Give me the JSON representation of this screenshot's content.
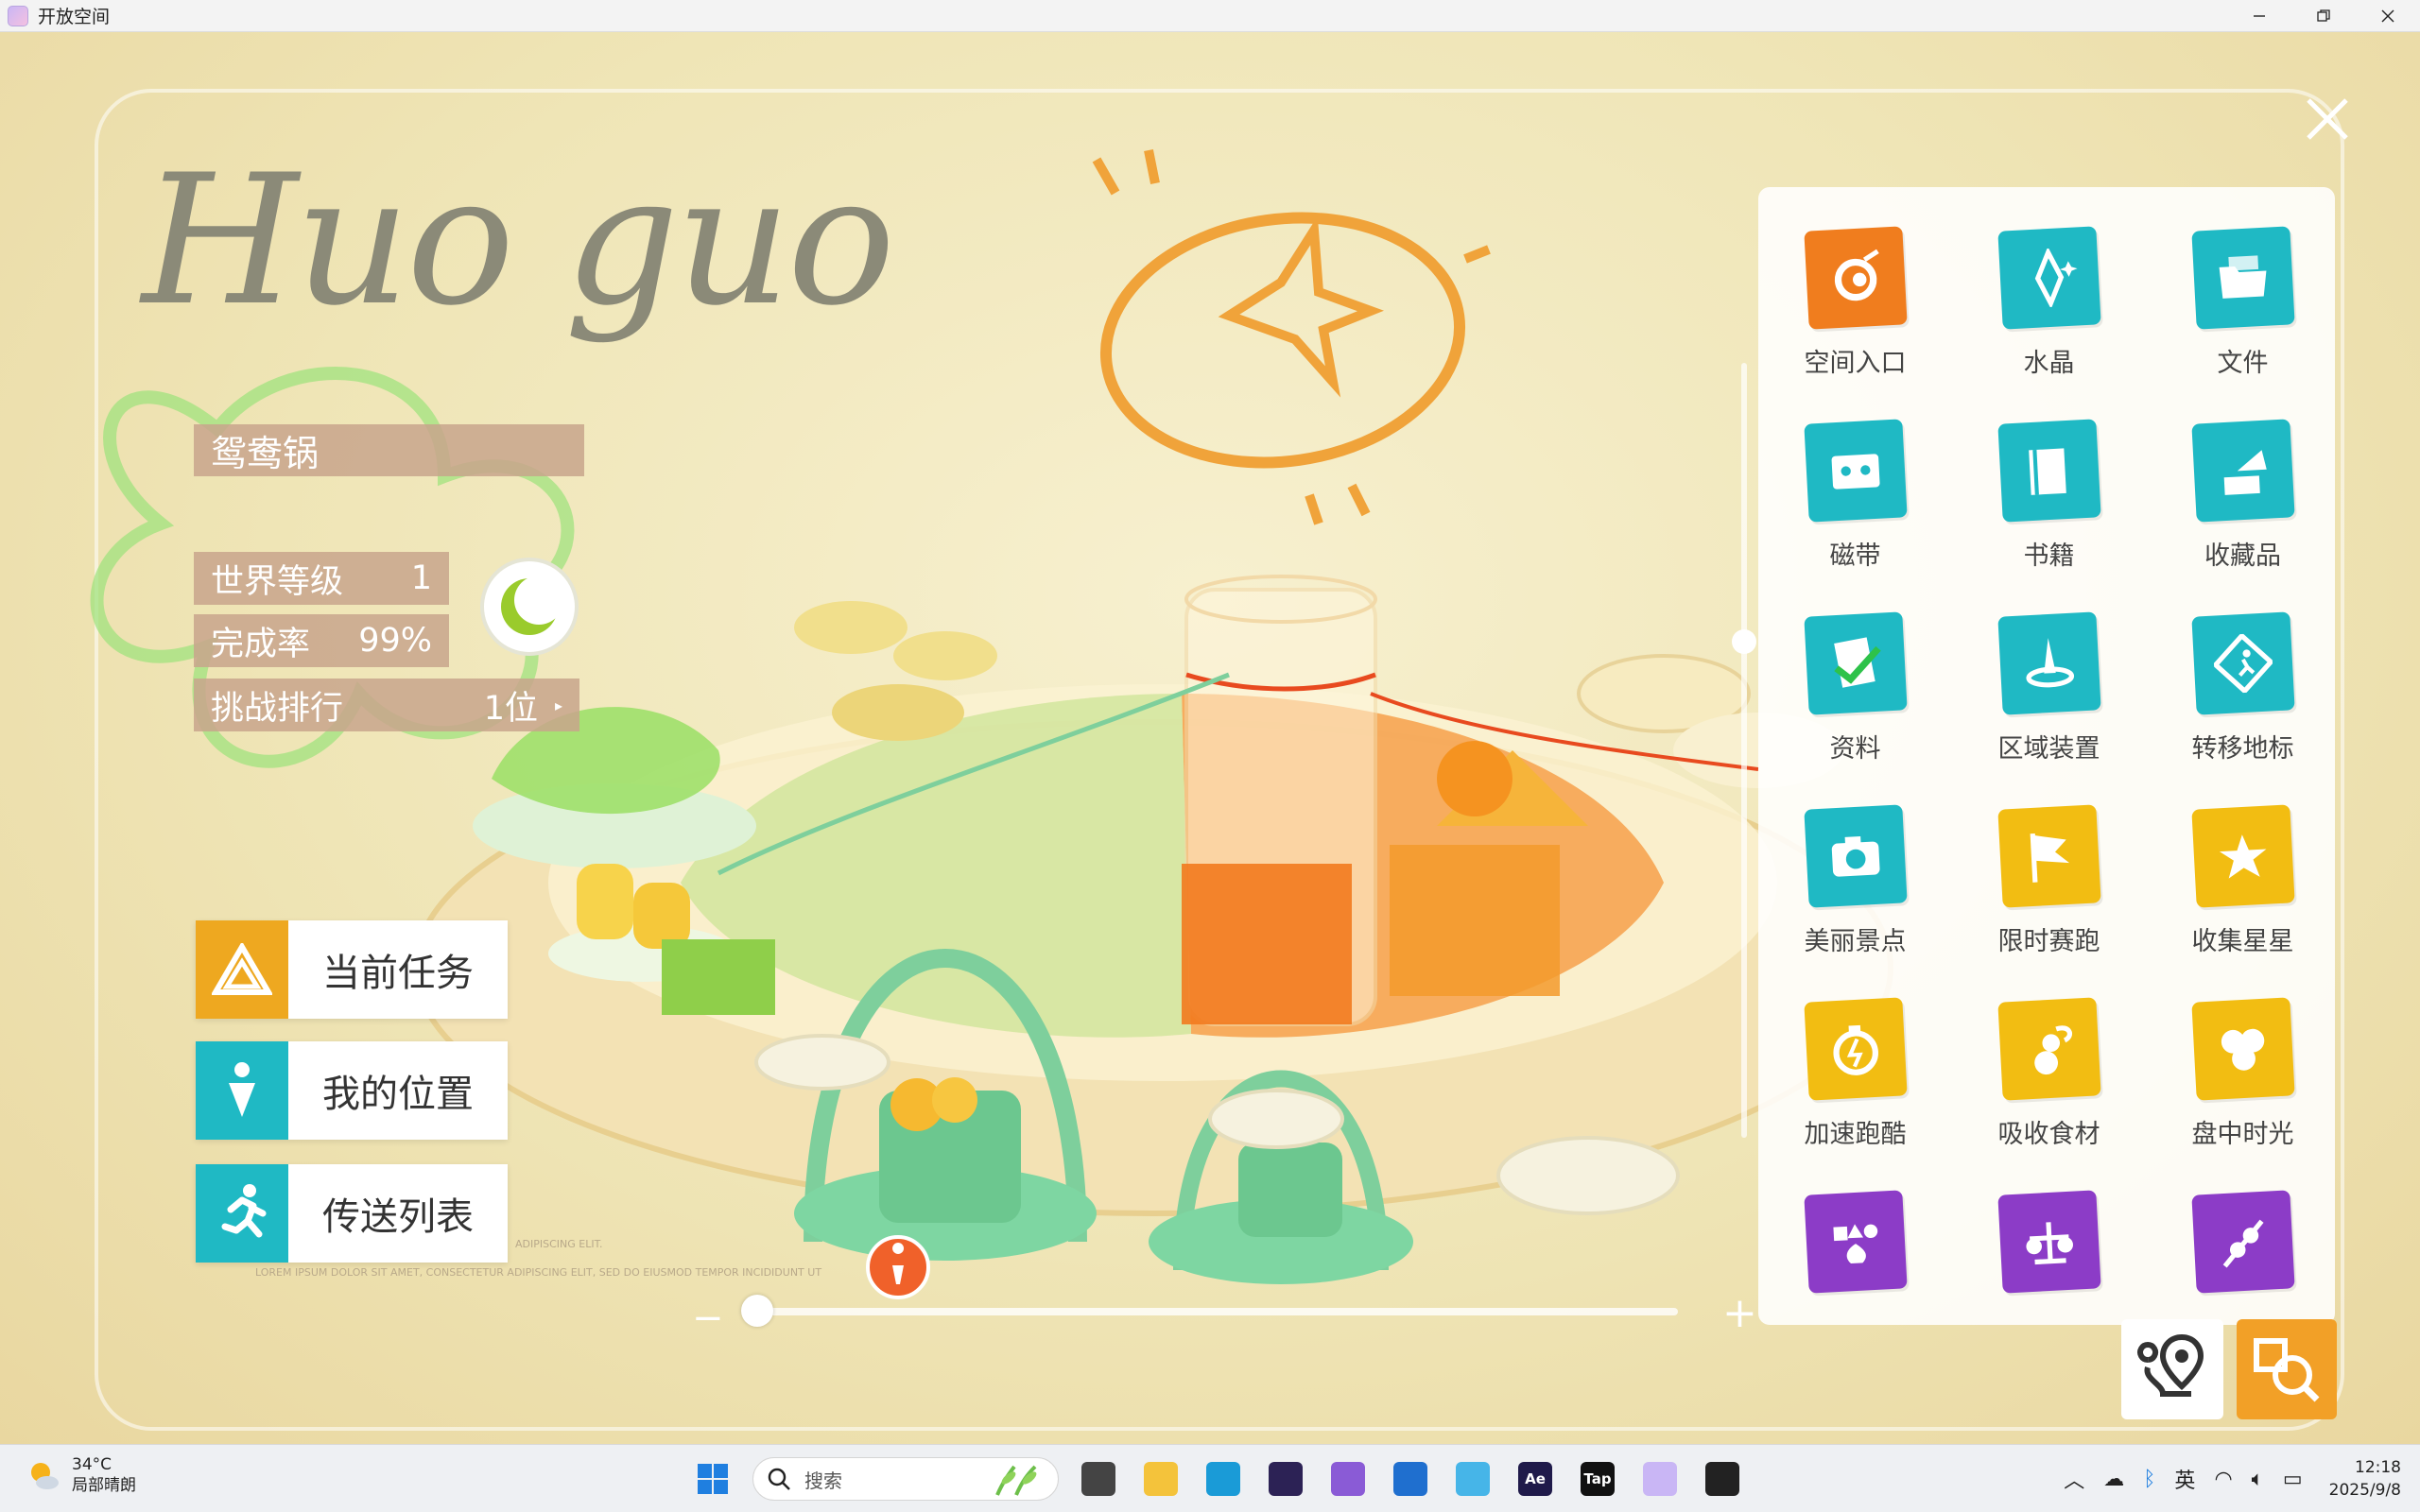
{
  "window": {
    "title": "开放空间",
    "controls": [
      "minimize",
      "maximize",
      "close"
    ]
  },
  "hud": {
    "script_title": "Huo guo",
    "map_name": "鸳鸯锅",
    "stats": {
      "level_label": "世界等级",
      "level_value": "1",
      "completion_label": "完成率",
      "completion_value": "99%",
      "rank_label": "挑战排行",
      "rank_value": "1位"
    },
    "buttons": {
      "task": "当前任务",
      "location": "我的位置",
      "teleport": "传送列表"
    },
    "fine_print": [
      "ADIPISCING ELIT.",
      "LOREM IPSUM DOLOR SIT AMET, CONSECTETUR ADIPISCING ELIT, SED DO EIUSMOD TEMPOR INCIDIDUNT UT"
    ],
    "zoom": {
      "minus": "−",
      "plus": "+"
    }
  },
  "panel": {
    "items": [
      {
        "label": "空间入口",
        "icon": "portal-icon",
        "color": "#f07d1e"
      },
      {
        "label": "水晶",
        "icon": "crystal-icon",
        "color": "#1fb9c4"
      },
      {
        "label": "文件",
        "icon": "folder-icon",
        "color": "#1fb9c4"
      },
      {
        "label": "磁带",
        "icon": "cassette-icon",
        "color": "#1fb9c4"
      },
      {
        "label": "书籍",
        "icon": "book-icon",
        "color": "#1fb9c4"
      },
      {
        "label": "收藏品",
        "icon": "gramophone-icon",
        "color": "#1fb9c4"
      },
      {
        "label": "资料",
        "icon": "document-check-icon",
        "color": "#1fb9c4"
      },
      {
        "label": "区域装置",
        "icon": "obelisk-icon",
        "color": "#1fb9c4"
      },
      {
        "label": "转移地标",
        "icon": "runner-sign-icon",
        "color": "#1fb9c4"
      },
      {
        "label": "美丽景点",
        "icon": "camera-icon",
        "color": "#1fb9c4"
      },
      {
        "label": "限时赛跑",
        "icon": "flag-icon",
        "color": "#f2bd12"
      },
      {
        "label": "收集星星",
        "icon": "star-icon",
        "color": "#f2bd12"
      },
      {
        "label": "加速跑酷",
        "icon": "stopwatch-icon",
        "color": "#f2bd12"
      },
      {
        "label": "吸收食材",
        "icon": "gourd-icon",
        "color": "#f2bd12"
      },
      {
        "label": "盘中时光",
        "icon": "plates-icon",
        "color": "#f2bd12"
      },
      {
        "label": "",
        "icon": "fire-shapes-icon",
        "color": "#8c3cc7"
      },
      {
        "label": "",
        "icon": "balance-icon",
        "color": "#8c3cc7"
      },
      {
        "label": "",
        "icon": "skewer-icon",
        "color": "#8c3cc7"
      }
    ]
  },
  "taskbar": {
    "weather_temp": "34°C",
    "weather_desc": "局部晴朗",
    "search_placeholder": "搜索",
    "apps": [
      {
        "name": "task-view",
        "label": "",
        "color": "#444444"
      },
      {
        "name": "file-explorer",
        "label": "",
        "color": "#f4c33b"
      },
      {
        "name": "edge",
        "label": "",
        "color": "#1a9bd7"
      },
      {
        "name": "eclipse",
        "label": "",
        "color": "#2c2255"
      },
      {
        "name": "visual-studio",
        "label": "",
        "color": "#8a5bd6"
      },
      {
        "name": "store",
        "label": "",
        "color": "#1f6fcf"
      },
      {
        "name": "qq-tool",
        "label": "",
        "color": "#46b5e8"
      },
      {
        "name": "after-effects",
        "label": "Ae",
        "color": "#1f1a4a"
      },
      {
        "name": "taptap",
        "label": "Tap",
        "color": "#111111"
      },
      {
        "name": "game-app",
        "label": "",
        "color": "#c9b6f5"
      },
      {
        "name": "qq",
        "label": "",
        "color": "#222222"
      }
    ],
    "tray": {
      "ime": "英",
      "time": "12:18",
      "date": "2025/9/8"
    }
  }
}
